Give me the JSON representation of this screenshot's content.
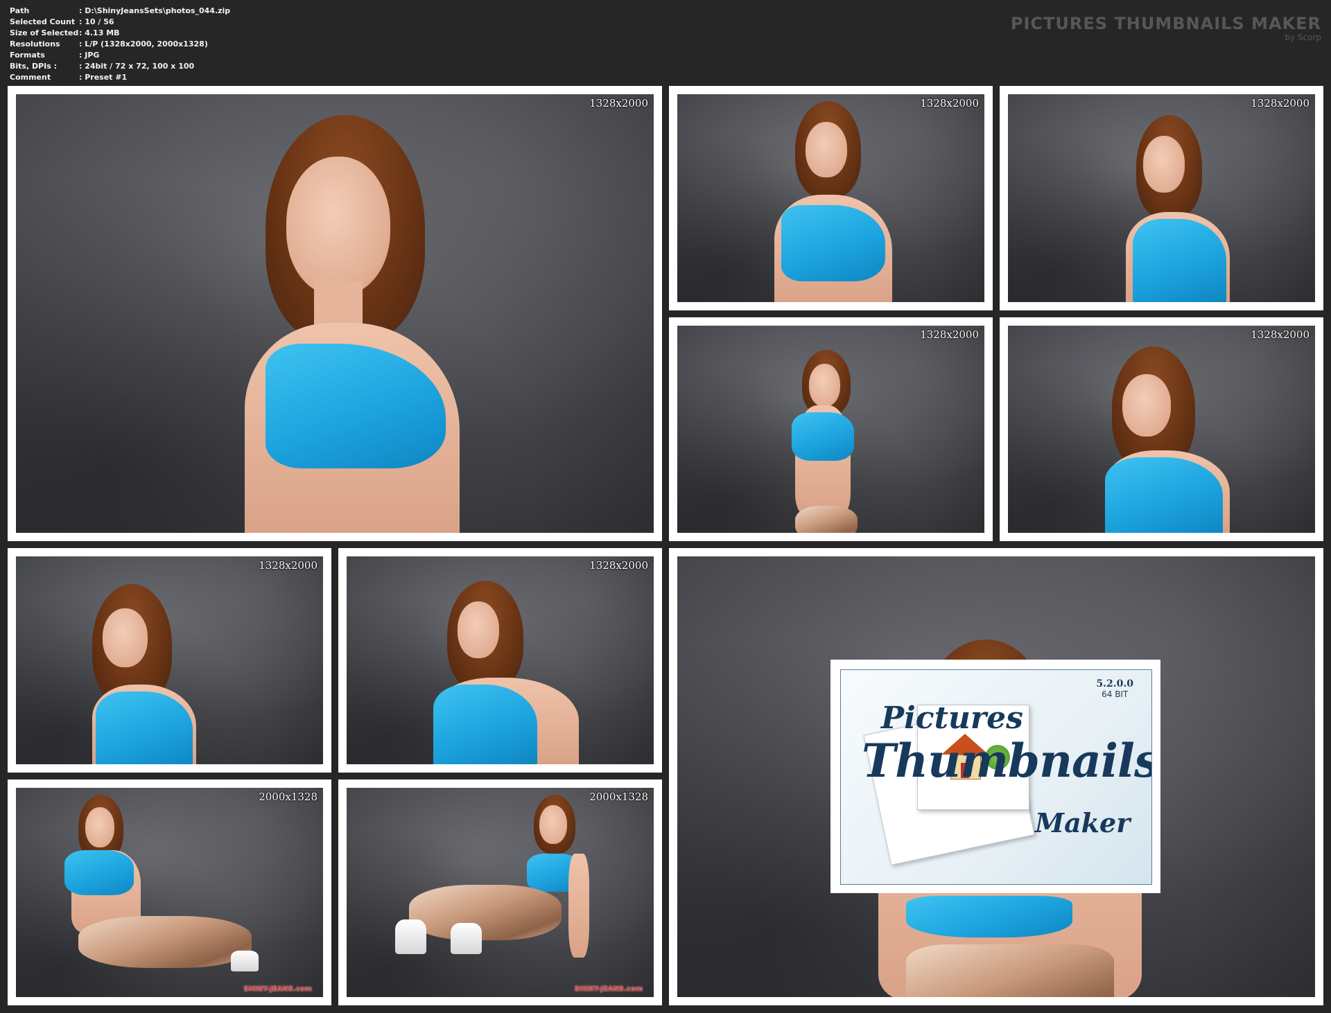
{
  "header": {
    "rows": [
      {
        "label": "Path",
        "value": ": D:\\ShinyJeansSets\\photos_044.zip"
      },
      {
        "label": "Selected Count",
        "value": ": 10 / 56"
      },
      {
        "label": "Size of Selected",
        "value": ": 4.13 MB"
      },
      {
        "label": "Resolutions",
        "value": ": L/P (1328x2000, 2000x1328)"
      },
      {
        "label": "Formats",
        "value": ": JPG"
      },
      {
        "label": "Bits, DPIs :",
        "value": ": 24bit / 72 x 72, 100 x 100"
      },
      {
        "label": "Comment",
        "value": ": Preset #1"
      }
    ]
  },
  "brand": {
    "title": "PICTURES THUMBNAILS MAKER",
    "by": "by Scorp"
  },
  "thumbnails": [
    {
      "resolution": "1328x2000",
      "watermark": ""
    },
    {
      "resolution": "1328x2000",
      "watermark": ""
    },
    {
      "resolution": "1328x2000",
      "watermark": ""
    },
    {
      "resolution": "1328x2000",
      "watermark": ""
    },
    {
      "resolution": "1328x2000",
      "watermark": ""
    },
    {
      "resolution": "1328x2000",
      "watermark": ""
    },
    {
      "resolution": "1328x2000",
      "watermark": ""
    },
    {
      "resolution": "2000x1328",
      "watermark": "SHINY-JEANS.com"
    },
    {
      "resolution": "2000x1328",
      "watermark": "SHINY-JEANS.com"
    },
    {
      "resolution": "",
      "watermark": ""
    }
  ],
  "logo": {
    "version": "5.2.0.0",
    "bits": "64 BIT",
    "word1": "Pictures",
    "word2": "Thumbnails",
    "word3": "Maker"
  },
  "colors": {
    "background": "#262626",
    "frame": "#ffffff",
    "top": "#1da4df",
    "logo_text": "#173a5c"
  }
}
